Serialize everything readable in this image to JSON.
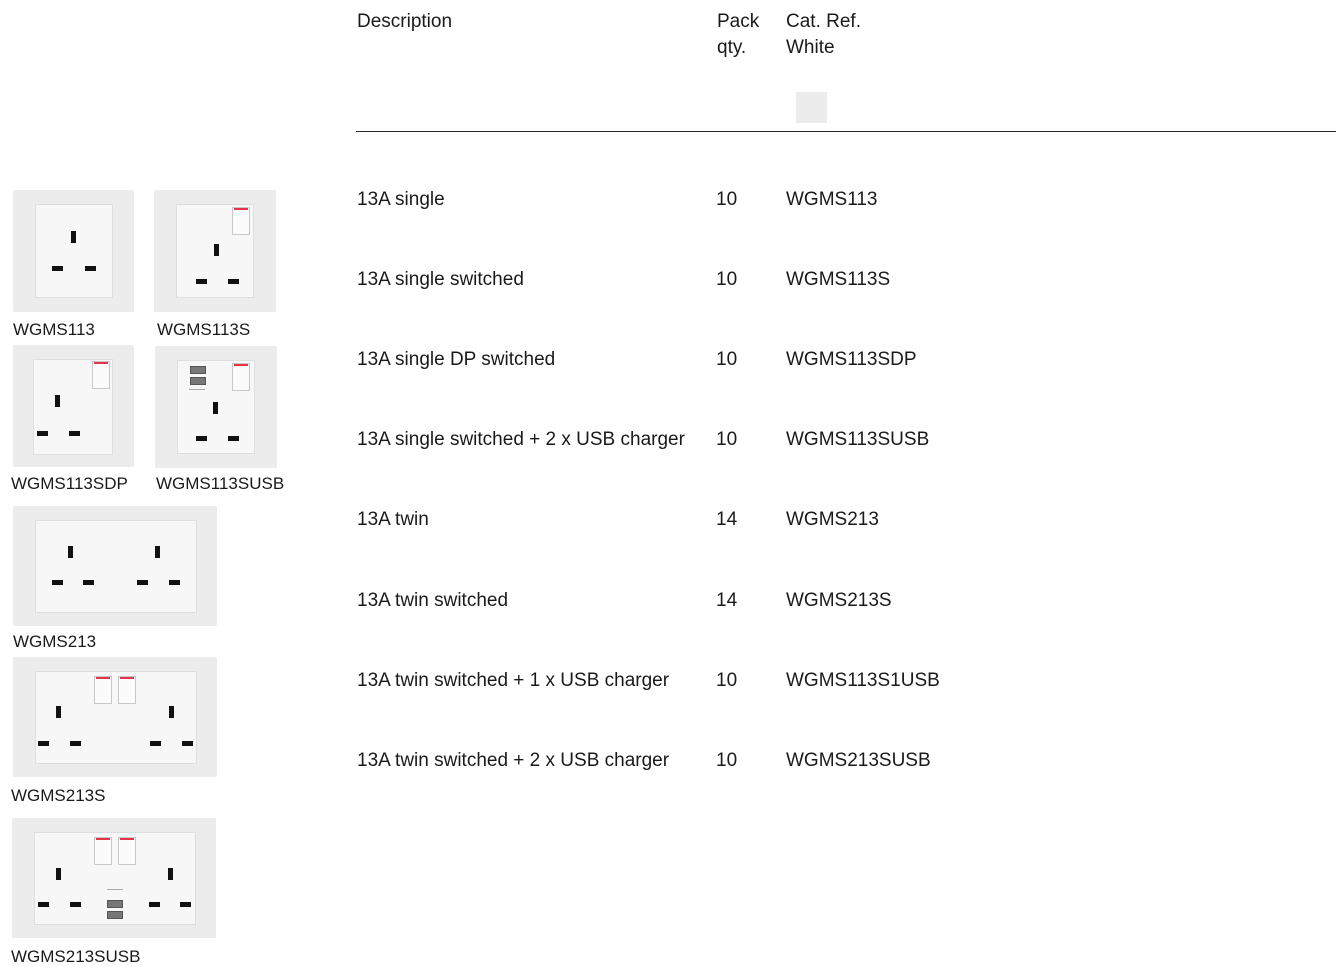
{
  "header": {
    "description": "Description",
    "pack_line1": "Pack",
    "pack_line2": "qty.",
    "catref_line1": "Cat. Ref.",
    "catref_line2": "White",
    "swatch_color": "#ececec"
  },
  "rows": [
    {
      "desc": "13A single",
      "qty": "10",
      "ref": "WGMS113"
    },
    {
      "desc": "13A single switched",
      "qty": "10",
      "ref": "WGMS113S"
    },
    {
      "desc": "13A single DP switched",
      "qty": "10",
      "ref": "WGMS113SDP"
    },
    {
      "desc": "13A single switched + 2 x USB charger",
      "qty": "10",
      "ref": "WGMS113SUSB"
    },
    {
      "desc": "13A twin",
      "qty": "14",
      "ref": "WGMS213"
    },
    {
      "desc": "13A twin switched",
      "qty": "14",
      "ref": "WGMS213S"
    },
    {
      "desc": "13A twin switched + 1 x USB charger",
      "qty": "10",
      "ref": "WGMS113S1USB"
    },
    {
      "desc": "13A twin switched + 2 x USB charger",
      "qty": "10",
      "ref": "WGMS213SUSB"
    }
  ],
  "captions": {
    "img1": "WGMS113",
    "img2": "WGMS113S",
    "img3": "WGMS113SDP",
    "img4": "WGMS113SUSB",
    "img5": "WGMS213",
    "img6": "WGMS213S",
    "img7": "WGMS213SUSB"
  },
  "colors": {
    "switch_indicator": "#e8324a",
    "plate": "#ececec"
  }
}
